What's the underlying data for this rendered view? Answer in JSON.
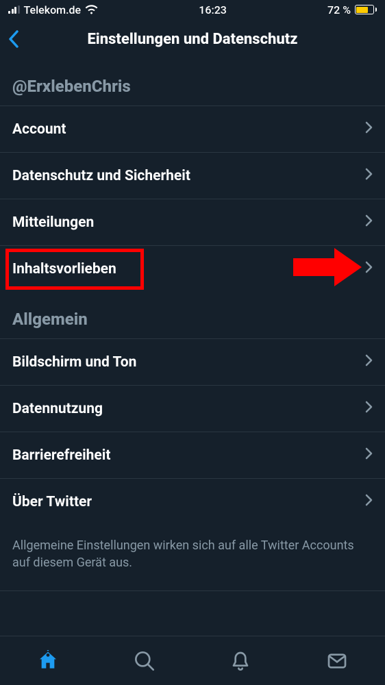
{
  "status": {
    "carrier": "Telekom.de",
    "time": "16:23",
    "battery_pct": "72 %"
  },
  "header": {
    "title": "Einstellungen und Datenschutz"
  },
  "account": {
    "handle": "@ErxlebenChris",
    "items": [
      {
        "label": "Account"
      },
      {
        "label": "Datenschutz und Sicherheit"
      },
      {
        "label": "Mitteilungen"
      },
      {
        "label": "Inhaltsvorlieben",
        "highlighted": true
      }
    ]
  },
  "general": {
    "title": "Allgemein",
    "items": [
      {
        "label": "Bildschirm und Ton"
      },
      {
        "label": "Datennutzung"
      },
      {
        "label": "Barrierefreiheit"
      },
      {
        "label": "Über Twitter"
      }
    ],
    "footnote": "Allgemeine Einstellungen wirken sich auf alle Twitter Accounts auf diesem Gerät aus."
  },
  "colors": {
    "accent": "#1d9bf0",
    "highlight": "#ff0000",
    "battery": "#ffcc00"
  }
}
